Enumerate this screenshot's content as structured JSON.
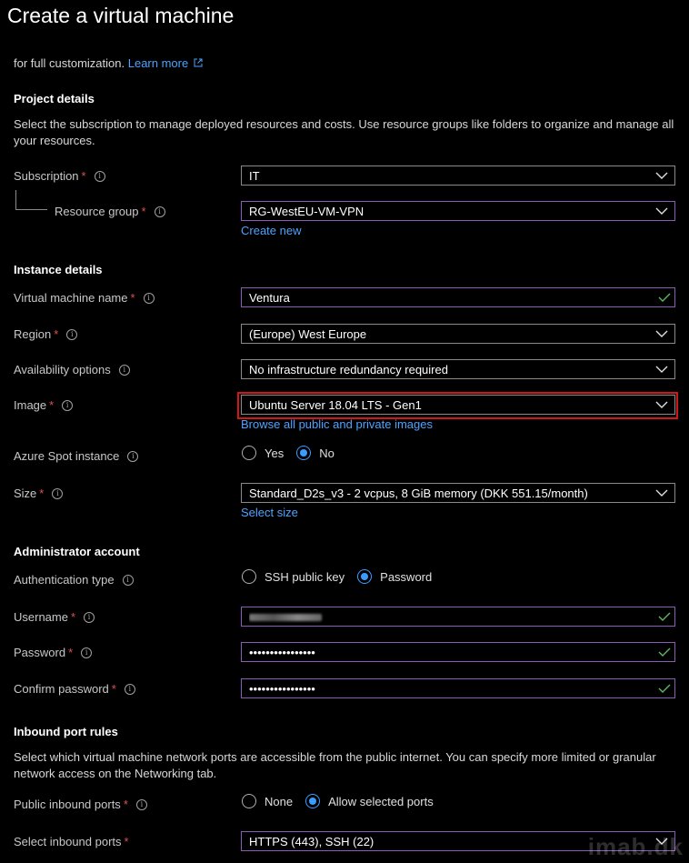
{
  "page": {
    "title": "Create a virtual machine",
    "intro_text": "for full customization.",
    "learn_more": "Learn more"
  },
  "project": {
    "heading": "Project details",
    "description": "Select the subscription to manage deployed resources and costs. Use resource groups like folders to organize and manage all your resources.",
    "subscription_label": "Subscription",
    "subscription_value": "IT",
    "resource_group_label": "Resource group",
    "resource_group_value": "RG-WestEU-VM-VPN",
    "create_new": "Create new"
  },
  "instance": {
    "heading": "Instance details",
    "vm_name_label": "Virtual machine name",
    "vm_name_value": "Ventura",
    "region_label": "Region",
    "region_value": "(Europe) West Europe",
    "availability_label": "Availability options",
    "availability_value": "No infrastructure redundancy required",
    "image_label": "Image",
    "image_value": "Ubuntu Server 18.04 LTS - Gen1",
    "browse_images": "Browse all public and private images",
    "spot_label": "Azure Spot instance",
    "spot_yes": "Yes",
    "spot_no": "No",
    "size_label": "Size",
    "size_value": "Standard_D2s_v3 - 2 vcpus, 8 GiB memory (DKK 551.15/month)",
    "select_size": "Select size"
  },
  "admin": {
    "heading": "Administrator account",
    "auth_label": "Authentication type",
    "auth_ssh": "SSH public key",
    "auth_password": "Password",
    "username_label": "Username",
    "password_label": "Password",
    "password_value": "••••••••••••••••",
    "confirm_label": "Confirm password",
    "confirm_value": "••••••••••••••••"
  },
  "inbound": {
    "heading": "Inbound port rules",
    "description": "Select which virtual machine network ports are accessible from the public internet. You can specify more limited or granular network access on the Networking tab.",
    "public_label": "Public inbound ports",
    "public_none": "None",
    "public_allow": "Allow selected ports",
    "select_label": "Select inbound ports",
    "select_value": "HTTPS (443), SSH (22)"
  },
  "watermark": "imab.dk",
  "colors": {
    "accent": "#3b9cff",
    "link": "#4da3ff",
    "required": "#e05050",
    "highlight": "#d01818",
    "valid_check": "#5fb85f",
    "focus_border": "#8b5cb8"
  }
}
